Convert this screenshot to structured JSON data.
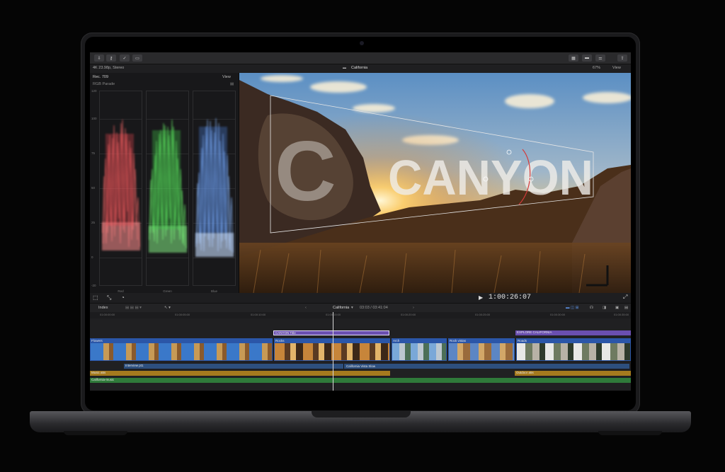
{
  "toolbar": {
    "left_icons": [
      "import-icon",
      "key-icon",
      "check-icon",
      "tag-icon"
    ],
    "right_icons": [
      "grid-icon",
      "filmstrip-icon",
      "sliders-icon",
      "share-icon"
    ]
  },
  "info": {
    "format": "4K 23.98p, Stereo",
    "project": "California",
    "zoom": "67%",
    "view_label": "View"
  },
  "scope": {
    "color_space": "Rec. 709",
    "view_label": "View",
    "title": "RGB Parade",
    "y_labels": [
      "120",
      "100",
      "75",
      "50",
      "25",
      "0",
      "-20"
    ],
    "channels": [
      "Red",
      "Green",
      "Blue"
    ]
  },
  "viewer": {
    "title_text": "CANYON"
  },
  "transport": {
    "timecode": "1:00:26:07"
  },
  "timeline": {
    "index_label": "Index",
    "project_name": "California",
    "duration": "03:03 / 03:41:04",
    "ruler_ticks": [
      "01:00:00:00",
      "01:00:05:00",
      "01:00:10:00",
      "01:00:15:00",
      "01:00:20:00",
      "01:00:25:00",
      "01:00:30:00",
      "01:00:35:00"
    ],
    "title_clips": [
      "CANYON Title",
      "EXPLORE CALIFORNIA"
    ],
    "video_clips": [
      "Flowers",
      "Rocks",
      "Arch",
      "Rock vistas",
      "Roads"
    ],
    "audio_lanes": [
      "Interview pt1",
      "California Vista Slow",
      "Music a5s",
      "Outdoor a5s",
      "California-music"
    ],
    "colors": {
      "title_clip": "#6a4fb0",
      "video_clip": "#2b56a8",
      "audio_blue": "#2d4f7e",
      "audio_orange": "#a57a1e",
      "audio_green": "#2f7a3a"
    }
  }
}
